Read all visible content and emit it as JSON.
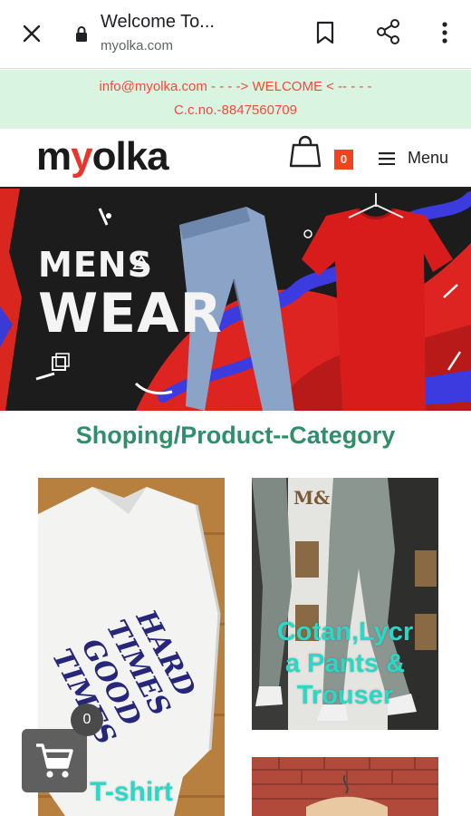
{
  "browser": {
    "title": "Welcome To...",
    "url": "myolka.com"
  },
  "announcement": {
    "line1": "info@myolka.com - - - -> WELCOME < -- - - -",
    "line2": "C.c.no.-8847560709"
  },
  "header": {
    "logo_prefix": "m",
    "logo_accent": "y",
    "logo_suffix": "olka",
    "cart_count": "0",
    "menu_label": "Menu"
  },
  "banner": {
    "line1": "MENS",
    "line2": "WEAR"
  },
  "category_heading": "Shoping/Product--Category",
  "products": [
    {
      "label": "T-shirt",
      "shirt_text": "HARD TIMES GOOD TIMES"
    },
    {
      "label": "Cotan,Lycra Pants & Trouser",
      "label_lines": [
        "Cotan,Lycr",
        "a Pants &",
        "Trouser"
      ],
      "brand_mark": "M&"
    },
    {
      "label": ""
    }
  ],
  "floating_cart": {
    "count": "0"
  },
  "colors": {
    "accent_red": "#e8362f",
    "announcement_bg": "#d9f5e2",
    "announcement_text": "#ef4c3c",
    "heading_green": "#2f8f6a",
    "label_teal": "#2ad8c5",
    "cart_badge": "#f0441f"
  }
}
